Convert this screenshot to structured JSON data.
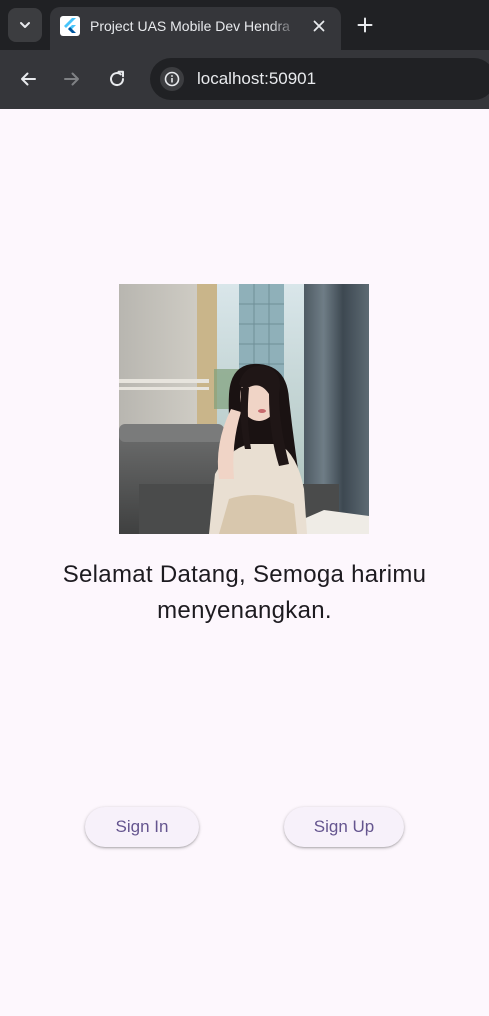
{
  "browser": {
    "tab": {
      "title": "Project UAS Mobile Dev Hendra",
      "favicon": "flutter-icon"
    },
    "address_bar": {
      "url": "localhost:50901"
    },
    "icons": {
      "tab_menu": "chevron-down-icon",
      "close_tab": "close-icon",
      "new_tab": "plus-icon",
      "back": "back-arrow-icon",
      "forward": "forward-arrow-icon",
      "reload": "reload-icon",
      "site_info": "info-icon"
    }
  },
  "page": {
    "hero_image": "photo of a young woman with long dark hair sitting on a gray sofa by a window",
    "welcome_message": "Selamat Datang, Semoga harimu menyenangkan.",
    "buttons": {
      "sign_in": "Sign In",
      "sign_up": "Sign Up"
    }
  },
  "colors": {
    "page_background": "#fdf7fd",
    "button_background": "#f7f1fa",
    "button_text": "#65558f",
    "text": "#1d1b20",
    "chrome_dark": "#202124",
    "chrome_toolbar": "#35363a"
  }
}
